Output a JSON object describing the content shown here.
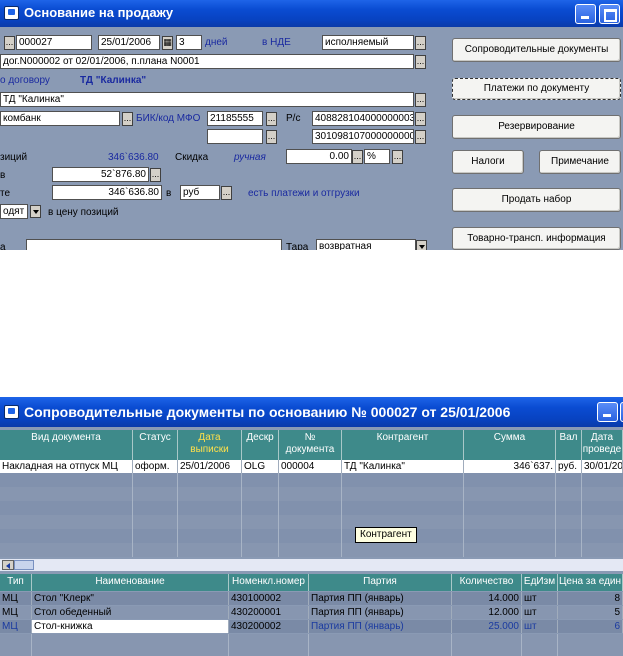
{
  "window1": {
    "title": "Основание на продажу",
    "number": "000027",
    "date": "25/01/2006",
    "days_value": "3",
    "days_label": "дней",
    "vat_label": "в НДЕ",
    "status_value": "исполняемый",
    "contract_line": "дог.N000002 от 02/01/2006, п.плана N0001",
    "by_contract_label": "о договору",
    "by_contract_value": "ТД \"Калинка\"",
    "counterparty": "ТД \"Калинка\"",
    "bank": "комбанк",
    "bik_label": "БИК/код МФО",
    "bik_value": "21185555",
    "rs_label": "Р/с",
    "rs_value": "408828104000000003",
    "rs_value2": "301098107000000000",
    "positions_label": "зиций",
    "positions_sum": "346`636.80",
    "discount_label": "Скидка",
    "discount_mode": "ручная",
    "discount_value": "0.00",
    "discount_unit": "%",
    "in_label": "в",
    "in_value": "52`876.80",
    "total_label": "те",
    "total_value": "346`636.80",
    "currency_prefix": "в",
    "currency_value": "руб",
    "payments_note": "есть платежи и отгрузки",
    "includes_value": "одят",
    "includes_label": "в цену позиций",
    "bottom_label": "а",
    "tara_label": "Тара",
    "tara_value": "возвратная",
    "buttons": {
      "docs": "Сопроводительные документы",
      "payments": "Платежи по документу",
      "reserve": "Резервирование",
      "taxes": "Налоги",
      "note": "Примечание",
      "sell_set": "Продать набор",
      "transport": "Товарно-трансп. информация"
    },
    "dots": "..."
  },
  "window2": {
    "title": "Сопроводительные документы по основанию № 000027 от 25/01/2006",
    "headers": [
      "Вид документа",
      "Статус",
      "Дата выписки",
      "Дескр",
      "№ документа",
      "Контрагент",
      "Сумма",
      "Вал",
      "Дата проведе"
    ],
    "row": [
      "Накладная на отпуск МЦ",
      "оформ.",
      "25/01/2006",
      "OLG",
      "000004",
      "ТД \"Калинка\"",
      "346`637.",
      "руб.",
      "30/01/20"
    ],
    "tooltip": "Контрагент",
    "items_headers": [
      "Тип",
      "Наименование",
      "Номенкл.номер",
      "Партия",
      "Количество",
      "ЕдИзм",
      "Цена за един"
    ],
    "items": [
      {
        "type": "МЦ",
        "name": "Стол \"Клерк\"",
        "code": "430100002",
        "batch": "Партия ПП (январь)",
        "qty": "14.000",
        "unit": "шт",
        "price": "8"
      },
      {
        "type": "МЦ",
        "name": "Стол обеденный",
        "code": "430200001",
        "batch": "Партия ПП (январь)",
        "qty": "12.000",
        "unit": "шт",
        "price": "5"
      },
      {
        "type": "МЦ",
        "name": "Стол-книжка",
        "code": "430200002",
        "batch": "Партия ПП (январь)",
        "qty": "25.000",
        "unit": "шт",
        "price": "6"
      }
    ]
  }
}
